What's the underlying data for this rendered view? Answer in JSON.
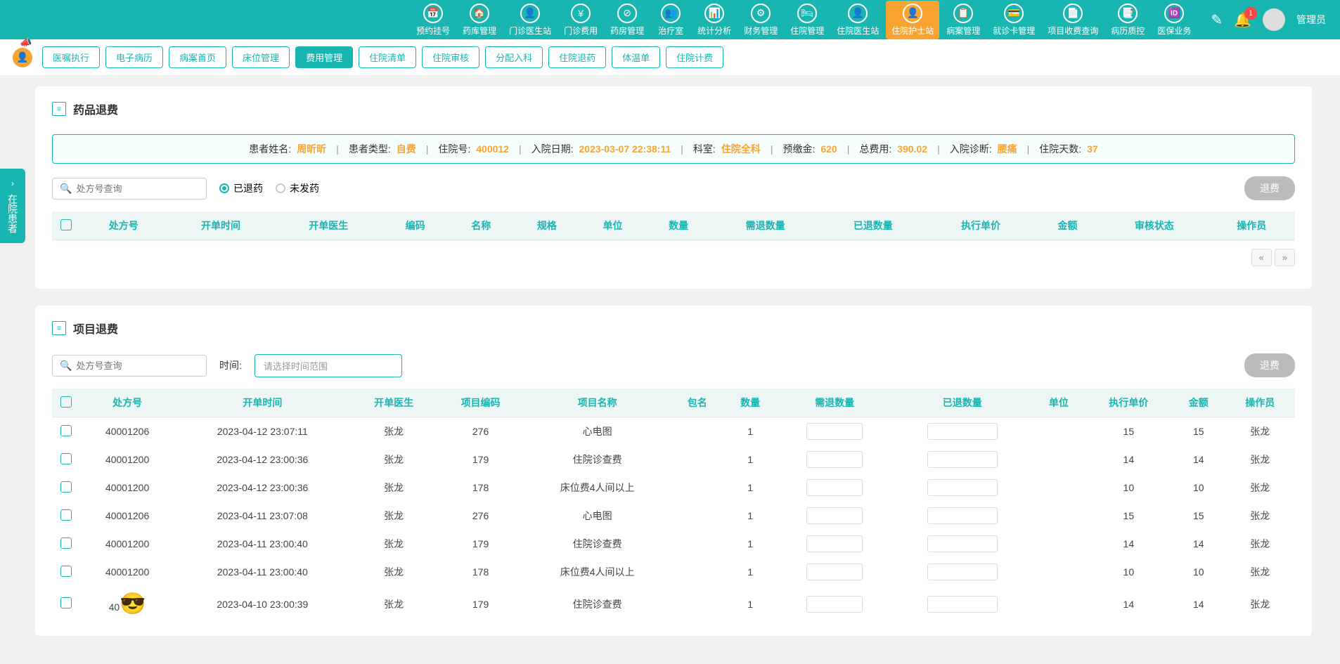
{
  "header": {
    "nav": [
      {
        "label": "预约挂号",
        "icon": "📅"
      },
      {
        "label": "药库管理",
        "icon": "🏠"
      },
      {
        "label": "门诊医生站",
        "icon": "👤"
      },
      {
        "label": "门诊费用",
        "icon": "¥"
      },
      {
        "label": "药房管理",
        "icon": "⊘"
      },
      {
        "label": "治疗室",
        "icon": "👥"
      },
      {
        "label": "统计分析",
        "icon": "📊"
      },
      {
        "label": "财务管理",
        "icon": "⚙"
      },
      {
        "label": "住院管理",
        "icon": "🛏"
      },
      {
        "label": "住院医生站",
        "icon": "👤"
      },
      {
        "label": "住院护士站",
        "icon": "👤",
        "active": true
      },
      {
        "label": "病案管理",
        "icon": "📋"
      },
      {
        "label": "就诊卡管理",
        "icon": "💳"
      },
      {
        "label": "项目收费查询",
        "icon": "📄"
      },
      {
        "label": "病历质控",
        "icon": "📑"
      },
      {
        "label": "医保业务",
        "icon": "🆔"
      }
    ],
    "badge": "1",
    "admin": "管理员"
  },
  "tabs": [
    {
      "label": "医嘱执行"
    },
    {
      "label": "电子病历"
    },
    {
      "label": "病案首页"
    },
    {
      "label": "床位管理"
    },
    {
      "label": "费用管理",
      "active": true
    },
    {
      "label": "住院清单"
    },
    {
      "label": "住院审核"
    },
    {
      "label": "分配入科"
    },
    {
      "label": "住院退药"
    },
    {
      "label": "体温单"
    },
    {
      "label": "住院计费"
    }
  ],
  "side_tab": {
    "arrow": "›",
    "label": "在院患者"
  },
  "panel1": {
    "title": "药品退费",
    "info": {
      "name_label": "患者姓名:",
      "name": "周昕昕",
      "type_label": "患者类型:",
      "type": "自费",
      "no_label": "住院号:",
      "no": "400012",
      "date_label": "入院日期:",
      "date": "2023-03-07 22:38:11",
      "dept_label": "科室:",
      "dept": "住院全科",
      "deposit_label": "预缴金:",
      "deposit": "620",
      "total_label": "总费用:",
      "total": "390.02",
      "diag_label": "入院诊断:",
      "diag": "腰痛",
      "days_label": "住院天数:",
      "days": "37"
    },
    "search_placeholder": "处方号查询",
    "radio1": "已退药",
    "radio2": "未发药",
    "refund_btn": "退费",
    "columns": [
      "处方号",
      "开单时间",
      "开单医生",
      "编码",
      "名称",
      "规格",
      "单位",
      "数量",
      "需退数量",
      "已退数量",
      "执行单价",
      "金额",
      "审核状态",
      "操作员"
    ],
    "pager_prev": "«",
    "pager_next": "»"
  },
  "panel2": {
    "title": "项目退费",
    "search_placeholder": "处方号查询",
    "time_label": "时间:",
    "date_placeholder": "请选择时间范围",
    "refund_btn": "退费",
    "columns": [
      "处方号",
      "开单时间",
      "开单医生",
      "项目编码",
      "项目名称",
      "包名",
      "数量",
      "需退数量",
      "已退数量",
      "单位",
      "执行单价",
      "金额",
      "操作员"
    ],
    "rows": [
      {
        "rx": "40001206",
        "time": "2023-04-12 23:07:11",
        "doc": "张龙",
        "code": "276",
        "name": "心电图",
        "pkg": "",
        "qty": "1",
        "price": "15",
        "amt": "15",
        "op": "张龙"
      },
      {
        "rx": "40001200",
        "time": "2023-04-12 23:00:36",
        "doc": "张龙",
        "code": "179",
        "name": "住院诊查费",
        "pkg": "",
        "qty": "1",
        "price": "14",
        "amt": "14",
        "op": "张龙"
      },
      {
        "rx": "40001200",
        "time": "2023-04-12 23:00:36",
        "doc": "张龙",
        "code": "178",
        "name": "床位费4人间以上",
        "pkg": "",
        "qty": "1",
        "price": "10",
        "amt": "10",
        "op": "张龙"
      },
      {
        "rx": "40001206",
        "time": "2023-04-11 23:07:08",
        "doc": "张龙",
        "code": "276",
        "name": "心电图",
        "pkg": "",
        "qty": "1",
        "price": "15",
        "amt": "15",
        "op": "张龙"
      },
      {
        "rx": "40001200",
        "time": "2023-04-11 23:00:40",
        "doc": "张龙",
        "code": "179",
        "name": "住院诊查费",
        "pkg": "",
        "qty": "1",
        "price": "14",
        "amt": "14",
        "op": "张龙"
      },
      {
        "rx": "40001200",
        "time": "2023-04-11 23:00:40",
        "doc": "张龙",
        "code": "178",
        "name": "床位费4人间以上",
        "pkg": "",
        "qty": "1",
        "price": "10",
        "amt": "10",
        "op": "张龙"
      },
      {
        "rx": "40",
        "time": "2023-04-10 23:00:39",
        "doc": "张龙",
        "code": "179",
        "name": "住院诊查费",
        "pkg": "",
        "qty": "1",
        "price": "14",
        "amt": "14",
        "op": "张龙",
        "emoji": true
      }
    ]
  }
}
